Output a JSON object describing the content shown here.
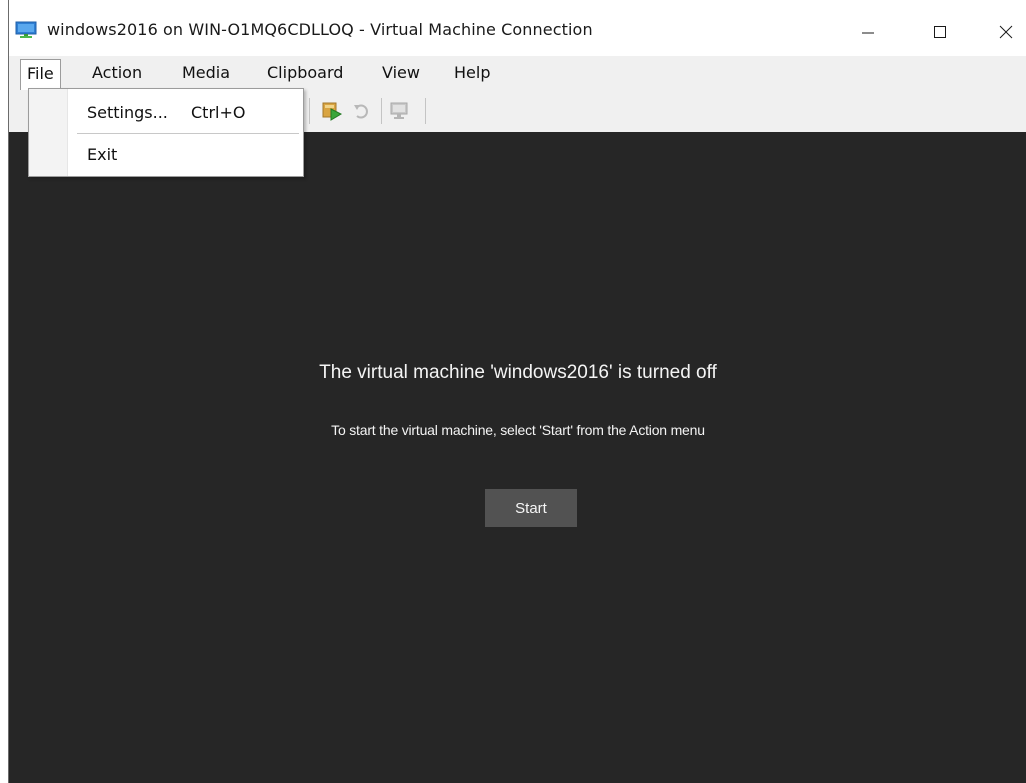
{
  "window": {
    "title": "windows2016 on WIN-O1MQ6CDLLOQ - Virtual Machine Connection",
    "minimize_glyph": "—",
    "maximize_glyph": "☐",
    "close_glyph": "✕"
  },
  "menubar": {
    "items": [
      {
        "label": "File",
        "active": true
      },
      {
        "label": "Action"
      },
      {
        "label": "Media"
      },
      {
        "label": "Clipboard"
      },
      {
        "label": "View"
      },
      {
        "label": "Help"
      }
    ]
  },
  "file_menu": {
    "items": [
      {
        "label": "Settings...",
        "shortcut": "Ctrl+O"
      },
      {
        "label": "Exit",
        "shortcut": ""
      }
    ]
  },
  "toolbar": {
    "icons": [
      "start-vm-icon",
      "revert-icon",
      "enhanced-session-icon"
    ]
  },
  "display": {
    "heading": "The virtual machine 'windows2016' is turned off",
    "subtext": "To start the virtual machine, select 'Start' from the Action menu",
    "start_label": "Start"
  },
  "colors": {
    "display_bg": "#262626",
    "button_bg": "#525252",
    "menubar_bg": "#f0f0f0"
  }
}
